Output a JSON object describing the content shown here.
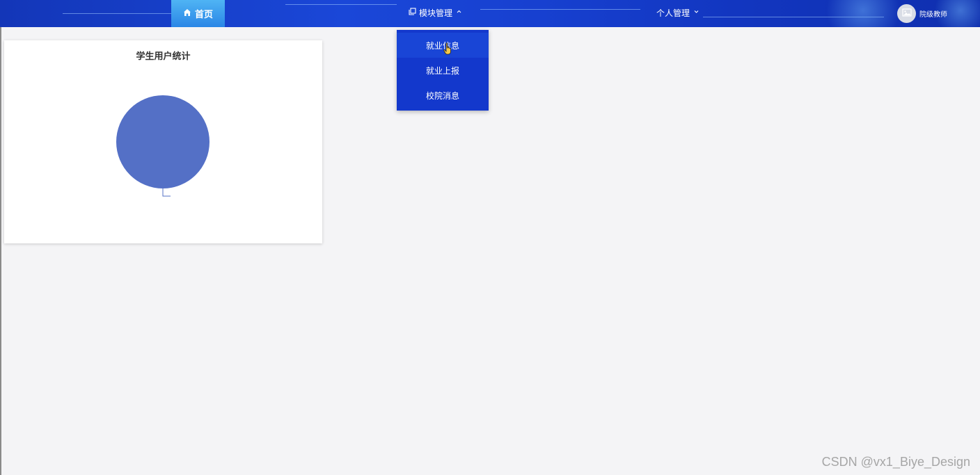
{
  "nav": {
    "home_label": "首页",
    "module_label": "模块管理",
    "personal_label": "个人管理",
    "user_name": "院级教师"
  },
  "dropdown": {
    "items": [
      {
        "label": "就业信息"
      },
      {
        "label": "就业上报"
      },
      {
        "label": "校院消息"
      }
    ]
  },
  "card": {
    "title": "学生用户统计"
  },
  "chart_data": {
    "type": "pie",
    "title": "学生用户统计",
    "slices": [
      {
        "value": 1,
        "color": "#5470c6"
      }
    ]
  },
  "colors": {
    "nav_bg": "#1740d0",
    "home_active": "#3a9eee",
    "dropdown_bg": "#1338cc",
    "pie_blue": "#5470c6"
  },
  "watermark": "CSDN @vx1_Biye_Design"
}
